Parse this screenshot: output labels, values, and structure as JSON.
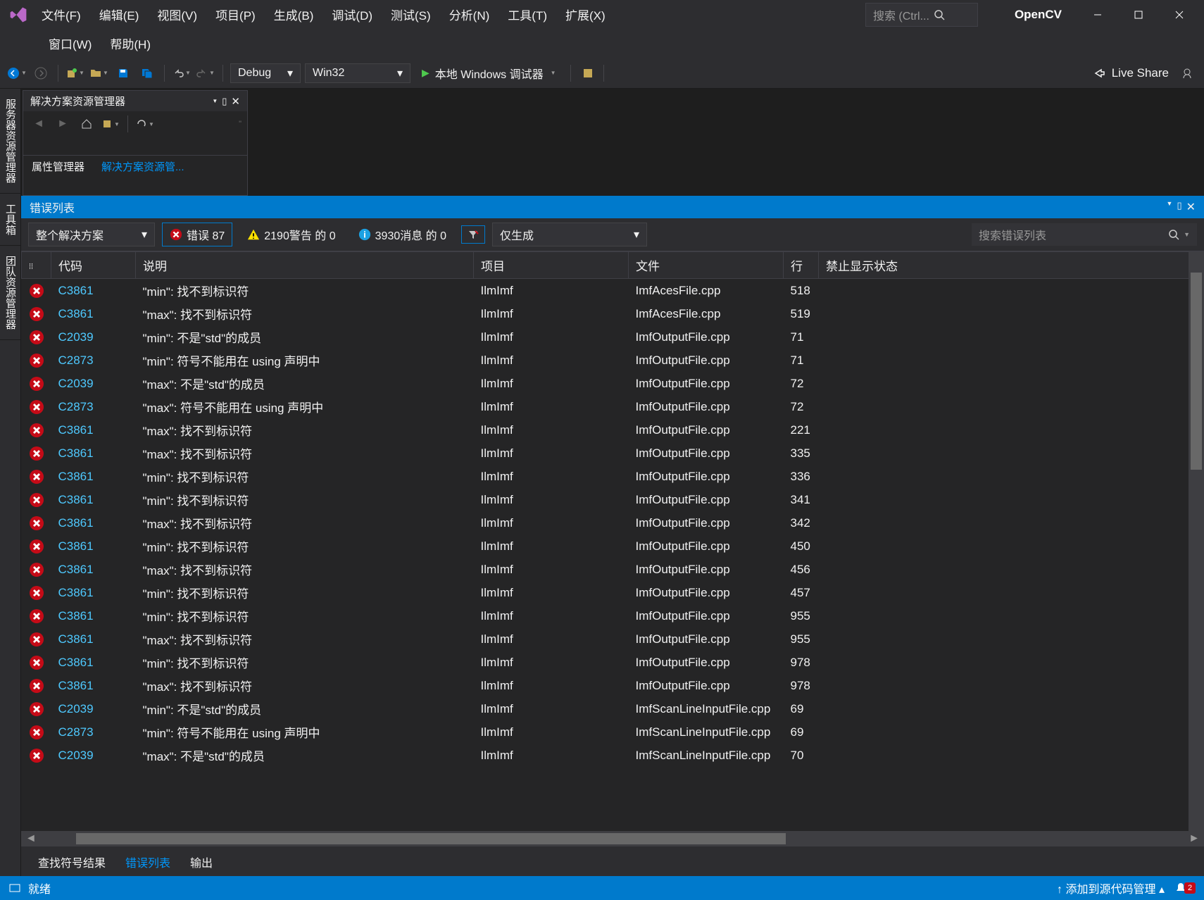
{
  "titlebar": {
    "menus": [
      "文件(F)",
      "编辑(E)",
      "视图(V)",
      "项目(P)",
      "生成(B)",
      "调试(D)",
      "测试(S)",
      "分析(N)",
      "工具(T)",
      "扩展(X)"
    ],
    "menus2": [
      "窗口(W)",
      "帮助(H)"
    ],
    "search_placeholder": "搜索 (Ctrl...",
    "project_name": "OpenCV"
  },
  "toolbar": {
    "config": "Debug",
    "platform": "Win32",
    "debugger_label": "本地 Windows 调试器",
    "live_share": "Live Share"
  },
  "left_tabs": [
    "服务器资源管理器",
    "工具箱",
    "团队资源管理器"
  ],
  "sol_explorer": {
    "title": "解决方案资源管理器",
    "tab1": "属性管理器",
    "tab2": "解决方案资源管..."
  },
  "error_panel": {
    "title": "错误列表",
    "scope": "整个解决方案",
    "errors_label": "错误 87",
    "warnings_label": "2190警告 的 0",
    "messages_label": "3930消息 的 0",
    "build_only": "仅生成",
    "search_placeholder": "搜索错误列表"
  },
  "error_columns": {
    "icon": "",
    "code": "代码",
    "desc": "说明",
    "proj": "项目",
    "file": "文件",
    "line": "行",
    "suppress": "禁止显示状态"
  },
  "errors": [
    {
      "code": "C3861",
      "desc": "\"min\": 找不到标识符",
      "proj": "IlmImf",
      "file": "ImfAcesFile.cpp",
      "line": "518"
    },
    {
      "code": "C3861",
      "desc": "\"max\": 找不到标识符",
      "proj": "IlmImf",
      "file": "ImfAcesFile.cpp",
      "line": "519"
    },
    {
      "code": "C2039",
      "desc": "\"min\": 不是\"std\"的成员",
      "proj": "IlmImf",
      "file": "ImfOutputFile.cpp",
      "line": "71"
    },
    {
      "code": "C2873",
      "desc": "\"min\": 符号不能用在 using 声明中",
      "proj": "IlmImf",
      "file": "ImfOutputFile.cpp",
      "line": "71"
    },
    {
      "code": "C2039",
      "desc": "\"max\": 不是\"std\"的成员",
      "proj": "IlmImf",
      "file": "ImfOutputFile.cpp",
      "line": "72"
    },
    {
      "code": "C2873",
      "desc": "\"max\": 符号不能用在 using 声明中",
      "proj": "IlmImf",
      "file": "ImfOutputFile.cpp",
      "line": "72"
    },
    {
      "code": "C3861",
      "desc": "\"max\": 找不到标识符",
      "proj": "IlmImf",
      "file": "ImfOutputFile.cpp",
      "line": "221"
    },
    {
      "code": "C3861",
      "desc": "\"max\": 找不到标识符",
      "proj": "IlmImf",
      "file": "ImfOutputFile.cpp",
      "line": "335"
    },
    {
      "code": "C3861",
      "desc": "\"min\": 找不到标识符",
      "proj": "IlmImf",
      "file": "ImfOutputFile.cpp",
      "line": "336"
    },
    {
      "code": "C3861",
      "desc": "\"min\": 找不到标识符",
      "proj": "IlmImf",
      "file": "ImfOutputFile.cpp",
      "line": "341"
    },
    {
      "code": "C3861",
      "desc": "\"max\": 找不到标识符",
      "proj": "IlmImf",
      "file": "ImfOutputFile.cpp",
      "line": "342"
    },
    {
      "code": "C3861",
      "desc": "\"min\": 找不到标识符",
      "proj": "IlmImf",
      "file": "ImfOutputFile.cpp",
      "line": "450"
    },
    {
      "code": "C3861",
      "desc": "\"max\": 找不到标识符",
      "proj": "IlmImf",
      "file": "ImfOutputFile.cpp",
      "line": "456"
    },
    {
      "code": "C3861",
      "desc": "\"min\": 找不到标识符",
      "proj": "IlmImf",
      "file": "ImfOutputFile.cpp",
      "line": "457"
    },
    {
      "code": "C3861",
      "desc": "\"min\": 找不到标识符",
      "proj": "IlmImf",
      "file": "ImfOutputFile.cpp",
      "line": "955"
    },
    {
      "code": "C3861",
      "desc": "\"max\": 找不到标识符",
      "proj": "IlmImf",
      "file": "ImfOutputFile.cpp",
      "line": "955"
    },
    {
      "code": "C3861",
      "desc": "\"min\": 找不到标识符",
      "proj": "IlmImf",
      "file": "ImfOutputFile.cpp",
      "line": "978"
    },
    {
      "code": "C3861",
      "desc": "\"max\": 找不到标识符",
      "proj": "IlmImf",
      "file": "ImfOutputFile.cpp",
      "line": "978"
    },
    {
      "code": "C2039",
      "desc": "\"min\": 不是\"std\"的成员",
      "proj": "IlmImf",
      "file": "ImfScanLineInputFile.cpp",
      "line": "69"
    },
    {
      "code": "C2873",
      "desc": "\"min\": 符号不能用在 using 声明中",
      "proj": "IlmImf",
      "file": "ImfScanLineInputFile.cpp",
      "line": "69"
    },
    {
      "code": "C2039",
      "desc": "\"max\": 不是\"std\"的成员",
      "proj": "IlmImf",
      "file": "ImfScanLineInputFile.cpp",
      "line": "70"
    }
  ],
  "bottom_tabs": {
    "symbols": "查找符号结果",
    "errors": "错误列表",
    "output": "输出"
  },
  "statusbar": {
    "ready": "就绪",
    "source_control": "添加到源代码管理",
    "notif_count": "2"
  }
}
